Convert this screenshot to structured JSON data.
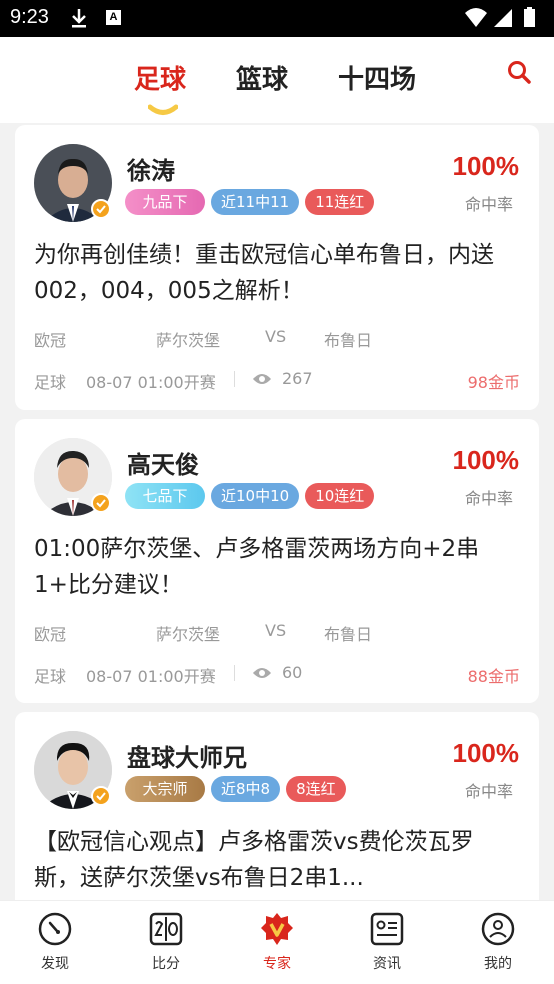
{
  "status_bar": {
    "time": "9:23",
    "a_badge": "A"
  },
  "top_tabs": [
    {
      "label": "足球",
      "active": true
    },
    {
      "label": "篮球",
      "active": false
    },
    {
      "label": "十四场",
      "active": false
    }
  ],
  "colors": {
    "accent": "#d9261c",
    "rate_tag": "#6aa8e0",
    "streak_tag": "#e95a5a",
    "price": "#ec6d6d",
    "underline": "#f6c945"
  },
  "experts": [
    {
      "name": "徐涛",
      "rank": "九品下",
      "rate_tag": "近11中11",
      "streak_tag": "11连红",
      "hit_rate": "100%",
      "hit_label": "命中率",
      "title": "为你再创佳绩！重击欧冠信心单布鲁日，内送002，004，005之解析！",
      "league": "欧冠",
      "home": "萨尔茨堡",
      "vs": "VS",
      "away": "布鲁日",
      "sport": "足球",
      "kickoff": "08-07 01:00开赛",
      "views": "267",
      "price": "98金币"
    },
    {
      "name": "高天俊",
      "rank": "七品下",
      "rate_tag": "近10中10",
      "streak_tag": "10连红",
      "hit_rate": "100%",
      "hit_label": "命中率",
      "title": "01:00萨尔茨堡、卢多格雷茨两场方向+2串1+比分建议！",
      "league": "欧冠",
      "home": "萨尔茨堡",
      "vs": "VS",
      "away": "布鲁日",
      "sport": "足球",
      "kickoff": "08-07 01:00开赛",
      "views": "60",
      "price": "88金币"
    },
    {
      "name": "盘球大师兄",
      "rank": "大宗师",
      "rate_tag": "近8中8",
      "streak_tag": "8连红",
      "hit_rate": "100%",
      "hit_label": "命中率",
      "title": "【欧冠信心观点】卢多格雷茨vs费伦茨瓦罗斯，送萨尔茨堡vs布鲁日2串1..."
    }
  ],
  "bottom_nav": [
    {
      "label": "发现",
      "icon": "compass-icon",
      "active": false
    },
    {
      "label": "比分",
      "icon": "scoreboard-icon",
      "active": false
    },
    {
      "label": "专家",
      "icon": "expert-badge-icon",
      "active": true
    },
    {
      "label": "资讯",
      "icon": "news-icon",
      "active": false
    },
    {
      "label": "我的",
      "icon": "profile-icon",
      "active": false
    }
  ]
}
